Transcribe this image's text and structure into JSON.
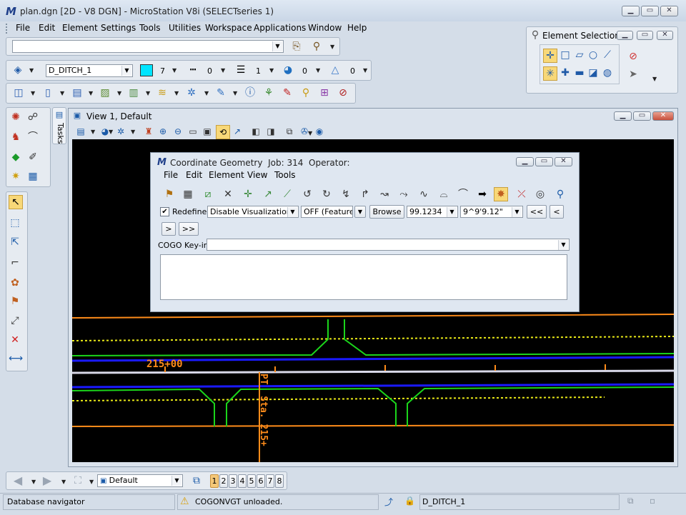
{
  "app": {
    "title": "plan.dgn [2D - V8 DGN] - MicroStation V8i (SELECTseries 1)",
    "logo": "M"
  },
  "menubar": [
    {
      "label": "File"
    },
    {
      "label": "Edit"
    },
    {
      "label": "Element"
    },
    {
      "label": "Settings"
    },
    {
      "label": "Tools"
    },
    {
      "label": "Utilities"
    },
    {
      "label": "Workspace"
    },
    {
      "label": "Applications"
    },
    {
      "label": "Window"
    },
    {
      "label": "Help"
    }
  ],
  "attributes": {
    "level": "D_DITCH_1",
    "color": "7",
    "color_swatch": "#00e5ff",
    "style": "0",
    "weight": "1",
    "transparency": "0",
    "priority": "0"
  },
  "element_selection": {
    "title": "Element Selection"
  },
  "tasks": {
    "label": "Tasks"
  },
  "view": {
    "title": "View 1, Default"
  },
  "cogo": {
    "title": "Coordinate Geometry",
    "job_label": "Job:",
    "job": "314",
    "operator_label": "Operator:",
    "menu": [
      {
        "label": "File"
      },
      {
        "label": "Edit"
      },
      {
        "label": "Element"
      },
      {
        "label": "View"
      },
      {
        "label": "Tools"
      }
    ],
    "redefine_label": "Redefine",
    "visualization": "Disable Visualization",
    "feature": "OFF (Feature)",
    "browse_label": "Browse",
    "precision": "99.1234",
    "angle_format": "9^9'9.12\"",
    "nav": [
      "<<",
      "<",
      ">",
      ">>"
    ],
    "keyin_label": "COGO Key-in:",
    "keyin_value": ""
  },
  "drawing": {
    "station_label": "215+00",
    "pt_label": "PT  Sta. 215+"
  },
  "bottom_toolbar": {
    "view_group": "Default",
    "view_numbers": [
      "1",
      "2",
      "3",
      "4",
      "5",
      "6",
      "7",
      "8"
    ]
  },
  "statusbar": {
    "left": "Database navigator",
    "message": "COGONVGT unloaded.",
    "active_level": "D_DITCH_1"
  },
  "colors": {
    "orange": "#ff8c1a",
    "green": "#1bd51b",
    "blue": "#1a1aff",
    "yellow_dash": "#e8e817",
    "canvas_bg": "#000000"
  }
}
